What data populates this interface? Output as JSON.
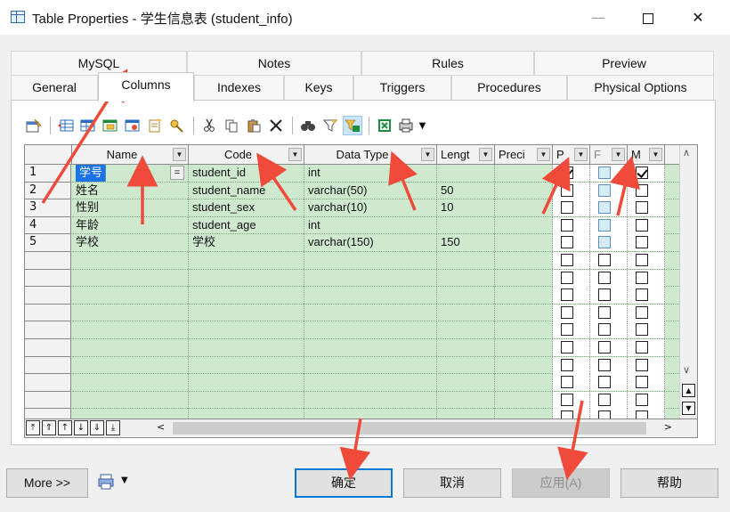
{
  "window": {
    "title": "Table Properties - 学生信息表 (student_info)",
    "minimize": "—",
    "maximize": "",
    "close": "✕"
  },
  "tabs": {
    "top": [
      "MySQL",
      "Notes",
      "Rules",
      "Preview"
    ],
    "bottom": [
      "General",
      "Columns",
      "Indexes",
      "Keys",
      "Triggers",
      "Procedures",
      "Physical Options"
    ],
    "active": "Columns"
  },
  "toolbar": {
    "icons": [
      "properties-icon",
      "insert-row-icon",
      "add-row-icon",
      "add-columns-icon",
      "reuse-columns-icon",
      "new-icon",
      "key-icon",
      "cut-icon",
      "copy-icon",
      "paste-icon",
      "delete-icon",
      "find-icon",
      "filter-icon",
      "customize-columns-icon",
      "excel-export-icon",
      "print-icon"
    ]
  },
  "grid": {
    "headers": {
      "name": "Name",
      "code": "Code",
      "data_type": "Data Type",
      "length": "Lengt",
      "precision": "Preci",
      "p": "P",
      "f": "F",
      "m": "M"
    },
    "rows": [
      {
        "num": "1",
        "name": "学号",
        "code": "student_id",
        "data_type": "int",
        "length": "",
        "p": true,
        "f": false,
        "m": true
      },
      {
        "num": "2",
        "name": "姓名",
        "code": "student_name",
        "data_type": "varchar(50)",
        "length": "50",
        "p": false,
        "f": false,
        "m": false
      },
      {
        "num": "3",
        "name": "性别",
        "code": "student_sex",
        "data_type": "varchar(10)",
        "length": "10",
        "p": false,
        "f": false,
        "m": false
      },
      {
        "num": "4",
        "name": "年龄",
        "code": "student_age",
        "data_type": "int",
        "length": "",
        "p": false,
        "f": false,
        "m": false
      },
      {
        "num": "5",
        "name": "学校",
        "code": "学校",
        "data_type": "varchar(150)",
        "length": "150",
        "p": false,
        "f": false,
        "m": false
      }
    ],
    "empty_rows": 10,
    "eq_button": "="
  },
  "buttons": {
    "more": "More >>",
    "ok": "确定",
    "cancel": "取消",
    "apply": "应用(A)",
    "help": "帮助"
  },
  "colors": {
    "grid_bg": "#cfe9cf",
    "selection": "#1a73e8",
    "arrow": "#f04a3a",
    "default_button_border": "#0078d7"
  }
}
